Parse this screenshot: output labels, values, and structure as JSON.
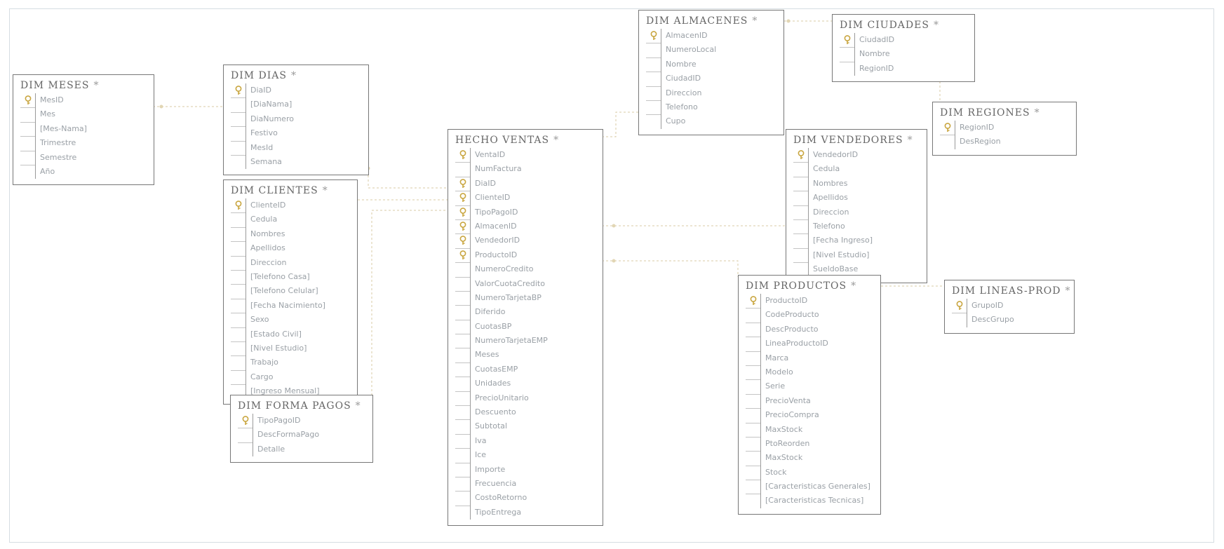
{
  "tables": {
    "dim_meses": {
      "title": "DIM MESES",
      "columns": [
        {
          "name": "MesID",
          "pk": true
        },
        {
          "name": "Mes"
        },
        {
          "name": "[Mes-Nama]"
        },
        {
          "name": "Trimestre"
        },
        {
          "name": "Semestre"
        },
        {
          "name": "Año"
        }
      ]
    },
    "dim_dias": {
      "title": "DIM DIAS",
      "columns": [
        {
          "name": "DiaID",
          "pk": true
        },
        {
          "name": "[DiaNama]"
        },
        {
          "name": "DiaNumero"
        },
        {
          "name": "Festivo"
        },
        {
          "name": "MesId"
        },
        {
          "name": "Semana"
        }
      ]
    },
    "dim_clientes": {
      "title": "DIM CLIENTES",
      "columns": [
        {
          "name": "ClienteID",
          "pk": true
        },
        {
          "name": "Cedula"
        },
        {
          "name": "Nombres"
        },
        {
          "name": "Apellidos"
        },
        {
          "name": "Direccion"
        },
        {
          "name": "[Telefono Casa]"
        },
        {
          "name": "[Telefono Celular]"
        },
        {
          "name": "[Fecha Nacimiento]"
        },
        {
          "name": "Sexo"
        },
        {
          "name": "[Estado Civil]"
        },
        {
          "name": "[Nivel Estudio]"
        },
        {
          "name": "Trabajo"
        },
        {
          "name": "Cargo"
        },
        {
          "name": "[Ingreso Mensual]"
        }
      ]
    },
    "dim_forma_pagos": {
      "title": "DIM FORMA PAGOS",
      "columns": [
        {
          "name": "TipoPagoID",
          "pk": true
        },
        {
          "name": "DescFormaPago"
        },
        {
          "name": "Detalle"
        }
      ]
    },
    "hecho_ventas": {
      "title": "HECHO VENTAS",
      "columns": [
        {
          "name": "VentaID",
          "pk": true
        },
        {
          "name": "NumFactura"
        },
        {
          "name": "DiaID",
          "pk": true
        },
        {
          "name": "ClienteID",
          "pk": true
        },
        {
          "name": "TipoPagoID",
          "pk": true
        },
        {
          "name": "AlmacenID",
          "pk": true
        },
        {
          "name": "VendedorID",
          "pk": true
        },
        {
          "name": "ProductoID",
          "pk": true
        },
        {
          "name": "NumeroCredito"
        },
        {
          "name": "ValorCuotaCredito"
        },
        {
          "name": "NumeroTarjetaBP"
        },
        {
          "name": "Diferido"
        },
        {
          "name": "CuotasBP"
        },
        {
          "name": "NumeroTarjetaEMP"
        },
        {
          "name": "Meses"
        },
        {
          "name": "CuotasEMP"
        },
        {
          "name": "Unidades"
        },
        {
          "name": "PrecioUnitario"
        },
        {
          "name": "Descuento"
        },
        {
          "name": "Subtotal"
        },
        {
          "name": "Iva"
        },
        {
          "name": "Ice"
        },
        {
          "name": "Importe"
        },
        {
          "name": "Frecuencia"
        },
        {
          "name": "CostoRetorno"
        },
        {
          "name": "TipoEntrega"
        }
      ]
    },
    "dim_almacenes": {
      "title": "DIM ALMACENES",
      "columns": [
        {
          "name": "AlmacenID",
          "pk": true
        },
        {
          "name": "NumeroLocal"
        },
        {
          "name": "Nombre"
        },
        {
          "name": "CiudadID"
        },
        {
          "name": "Direccion"
        },
        {
          "name": "Telefono"
        },
        {
          "name": "Cupo"
        }
      ]
    },
    "dim_ciudades": {
      "title": "DIM CIUDADES",
      "columns": [
        {
          "name": "CiudadID",
          "pk": true
        },
        {
          "name": "Nombre"
        },
        {
          "name": "RegionID"
        }
      ]
    },
    "dim_regiones": {
      "title": "DIM REGIONES",
      "columns": [
        {
          "name": "RegionID",
          "pk": true
        },
        {
          "name": "DesRegion"
        }
      ]
    },
    "dim_vendedores": {
      "title": "DIM VENDEDORES",
      "columns": [
        {
          "name": "VendedorID",
          "pk": true
        },
        {
          "name": "Cedula"
        },
        {
          "name": "Nombres"
        },
        {
          "name": "Apellidos"
        },
        {
          "name": "Direccion"
        },
        {
          "name": "Telefono"
        },
        {
          "name": "[Fecha Ingreso]"
        },
        {
          "name": "[Nivel Estudio]"
        },
        {
          "name": "SueldoBase"
        }
      ]
    },
    "dim_productos": {
      "title": "DIM PRODUCTOS",
      "columns": [
        {
          "name": "ProductoID",
          "pk": true
        },
        {
          "name": "CodeProducto"
        },
        {
          "name": "DescProducto"
        },
        {
          "name": "LineaProductoID"
        },
        {
          "name": "Marca"
        },
        {
          "name": "Modelo"
        },
        {
          "name": "Serie"
        },
        {
          "name": "PrecioVenta"
        },
        {
          "name": "PrecioCompra"
        },
        {
          "name": "MaxStock"
        },
        {
          "name": "PtoReorden"
        },
        {
          "name": "MaxStock"
        },
        {
          "name": "Stock"
        },
        {
          "name": "[Caracteristicas Generales]"
        },
        {
          "name": "[Caracteristicas Tecnicas]"
        }
      ]
    },
    "dim_lineas_prod": {
      "title": "DIM LINEAS-PROD",
      "columns": [
        {
          "name": "GrupoID",
          "pk": true
        },
        {
          "name": "DescGrupo"
        }
      ]
    }
  },
  "star_symbol": "*",
  "colors": {
    "border": "#777777",
    "text": "#9aa0a6",
    "title": "#666666",
    "key": "#c9a640",
    "link": "#d9cba6"
  }
}
